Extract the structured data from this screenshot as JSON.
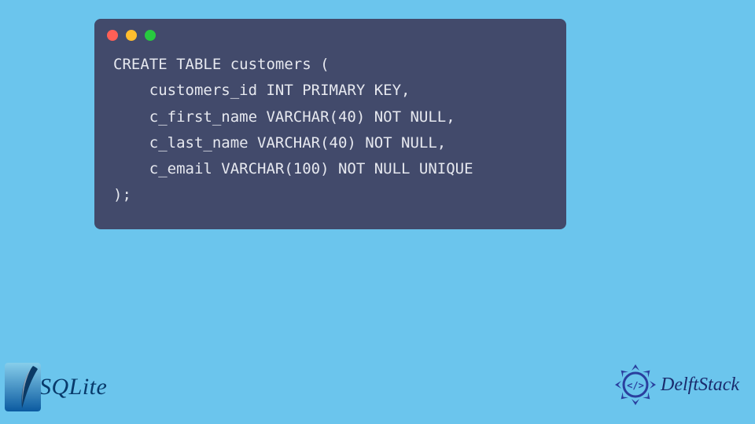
{
  "traffic_colors": {
    "close": "#ff5f56",
    "minimize": "#ffbd2e",
    "zoom": "#27c93f"
  },
  "code": "CREATE TABLE customers (\n    customers_id INT PRIMARY KEY,\n    c_first_name VARCHAR(40) NOT NULL,\n    c_last_name VARCHAR(40) NOT NULL,\n    c_email VARCHAR(100) NOT NULL UNIQUE\n);",
  "logos": {
    "sqlite": "SQLite",
    "delftstack": "DelftStack"
  },
  "sqlite_gradient": {
    "top": "#87ceeb",
    "bottom": "#0b5aa0"
  },
  "delft_color": "#2a3f9e"
}
